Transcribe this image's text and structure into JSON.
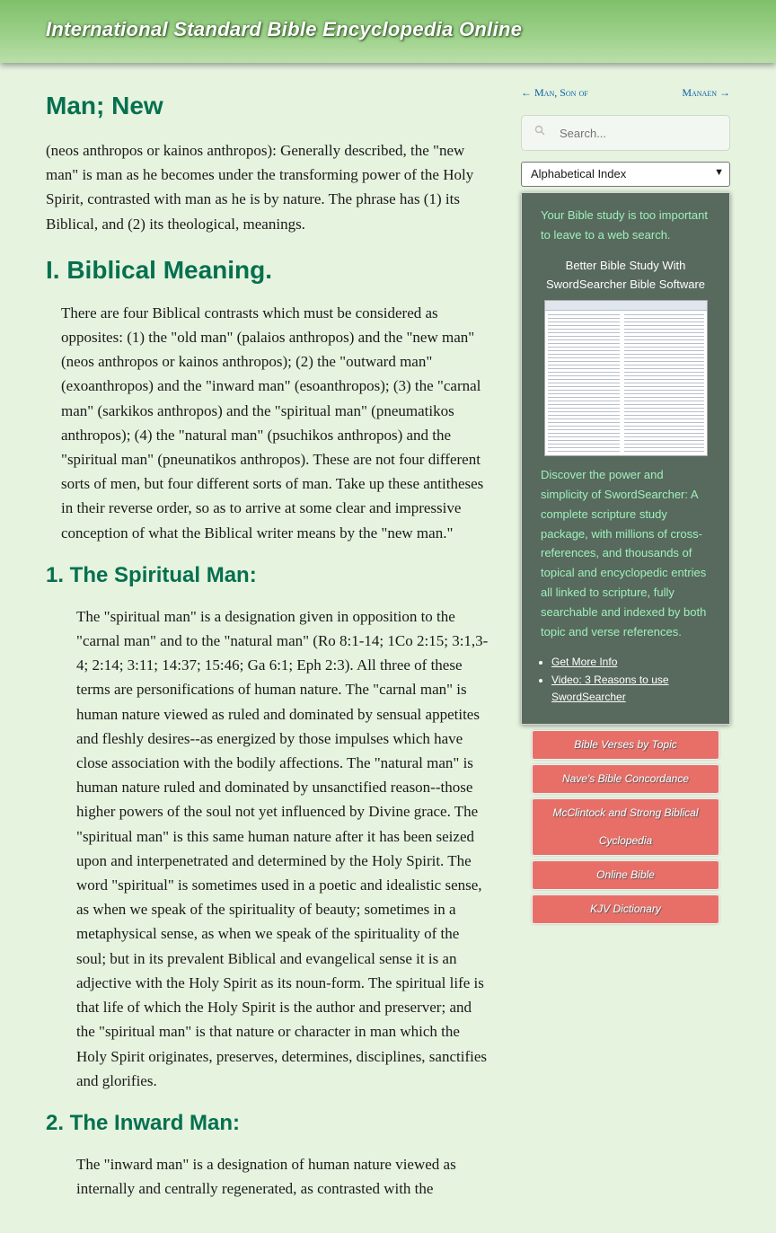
{
  "header": {
    "site_title": "International Standard Bible Encyclopedia Online"
  },
  "article": {
    "title": "Man; New",
    "intro": "(neos anthropos or kainos anthropos): Generally described, the \"new man\" is man as he becomes under the transforming power of the Holy Spirit, contrasted with man as he is by nature. The phrase has (1) its Biblical, and (2) its theological, meanings.",
    "section1_heading": "I. Biblical Meaning.",
    "section1_text": "There are four Biblical contrasts which must be considered as opposites: (1) the \"old man\" (palaios anthropos) and the \"new man\" (neos anthropos or kainos anthropos); (2) the \"outward man\" (exoanthropos) and the \"inward man\" (esoanthropos); (3) the \"carnal man\" (sarkikos anthropos) and the \"spiritual man\" (pneumatikos anthropos); (4) the \"natural man\" (psuchikos anthropos) and the \"spiritual man\" (pneunatikos anthropos). These are not four different sorts of men, but four different sorts of man. Take up these antitheses in their reverse order, so as to arrive at some clear and impressive conception of what the Biblical writer means by the \"new man.\"",
    "sub1_heading": "1. The Spiritual Man:",
    "sub1_text": "The \"spiritual man\" is a designation given in opposition to the \"carnal man\" and to the \"natural man\" (Ro 8:1-14; 1Co 2:15; 3:1,3-4; 2:14; 3:11; 14:37; 15:46; Ga 6:1; Eph 2:3). All three of these terms are personifications of human nature. The \"carnal man\" is human nature viewed as ruled and dominated by sensual appetites and fleshly desires--as energized by those impulses which have close association with the bodily affections. The \"natural man\" is human nature ruled and dominated by unsanctified reason--those higher powers of the soul not yet influenced by Divine grace. The \"spiritual man\" is this same human nature after it has been seized upon and interpenetrated and determined by the Holy Spirit. The word \"spiritual\" is sometimes used in a poetic and idealistic sense, as when we speak of the spirituality of beauty; sometimes in a metaphysical sense, as when we speak of the spirituality of the soul; but in its prevalent Biblical and evangelical sense it is an adjective with the Holy Spirit as its noun-form. The spiritual life is that life of which the Holy Spirit is the author and preserver; and the \"spiritual man\" is that nature or character in man which the Holy Spirit originates, preserves, determines, disciplines, sanctifies and glorifies.",
    "sub2_heading": "2. The Inward Man:",
    "sub2_text": "The \"inward man\" is a designation of human nature viewed as internally and centrally regenerated, as contrasted with the"
  },
  "sidebar": {
    "prev_link": "← Man, Son of",
    "next_link": "Manaen →",
    "search_placeholder": "Search...",
    "index_select": "Alphabetical Index",
    "ad": {
      "tagline": "Your Bible study is too important to leave to a web search.",
      "caption": "Better Bible Study With SwordSearcher Bible Software",
      "description": "Discover the power and simplicity of SwordSearcher: A complete scripture study package, with millions of cross-references, and thousands of topical and encyclopedic entries all linked to scripture, fully searchable and indexed by both topic and verse references.",
      "links": [
        "Get More Info",
        "Video: 3 Reasons to use SwordSearcher"
      ]
    },
    "buttons": [
      "Bible Verses by Topic",
      "Nave's Bible Concordance",
      "McClintock and Strong Biblical Cyclopedia",
      "Online Bible",
      "KJV Dictionary"
    ]
  },
  "colors": {
    "heading": "#05704f",
    "background": "#e6f3df",
    "button": "#e86f68",
    "ad_bg": "#58695e"
  }
}
